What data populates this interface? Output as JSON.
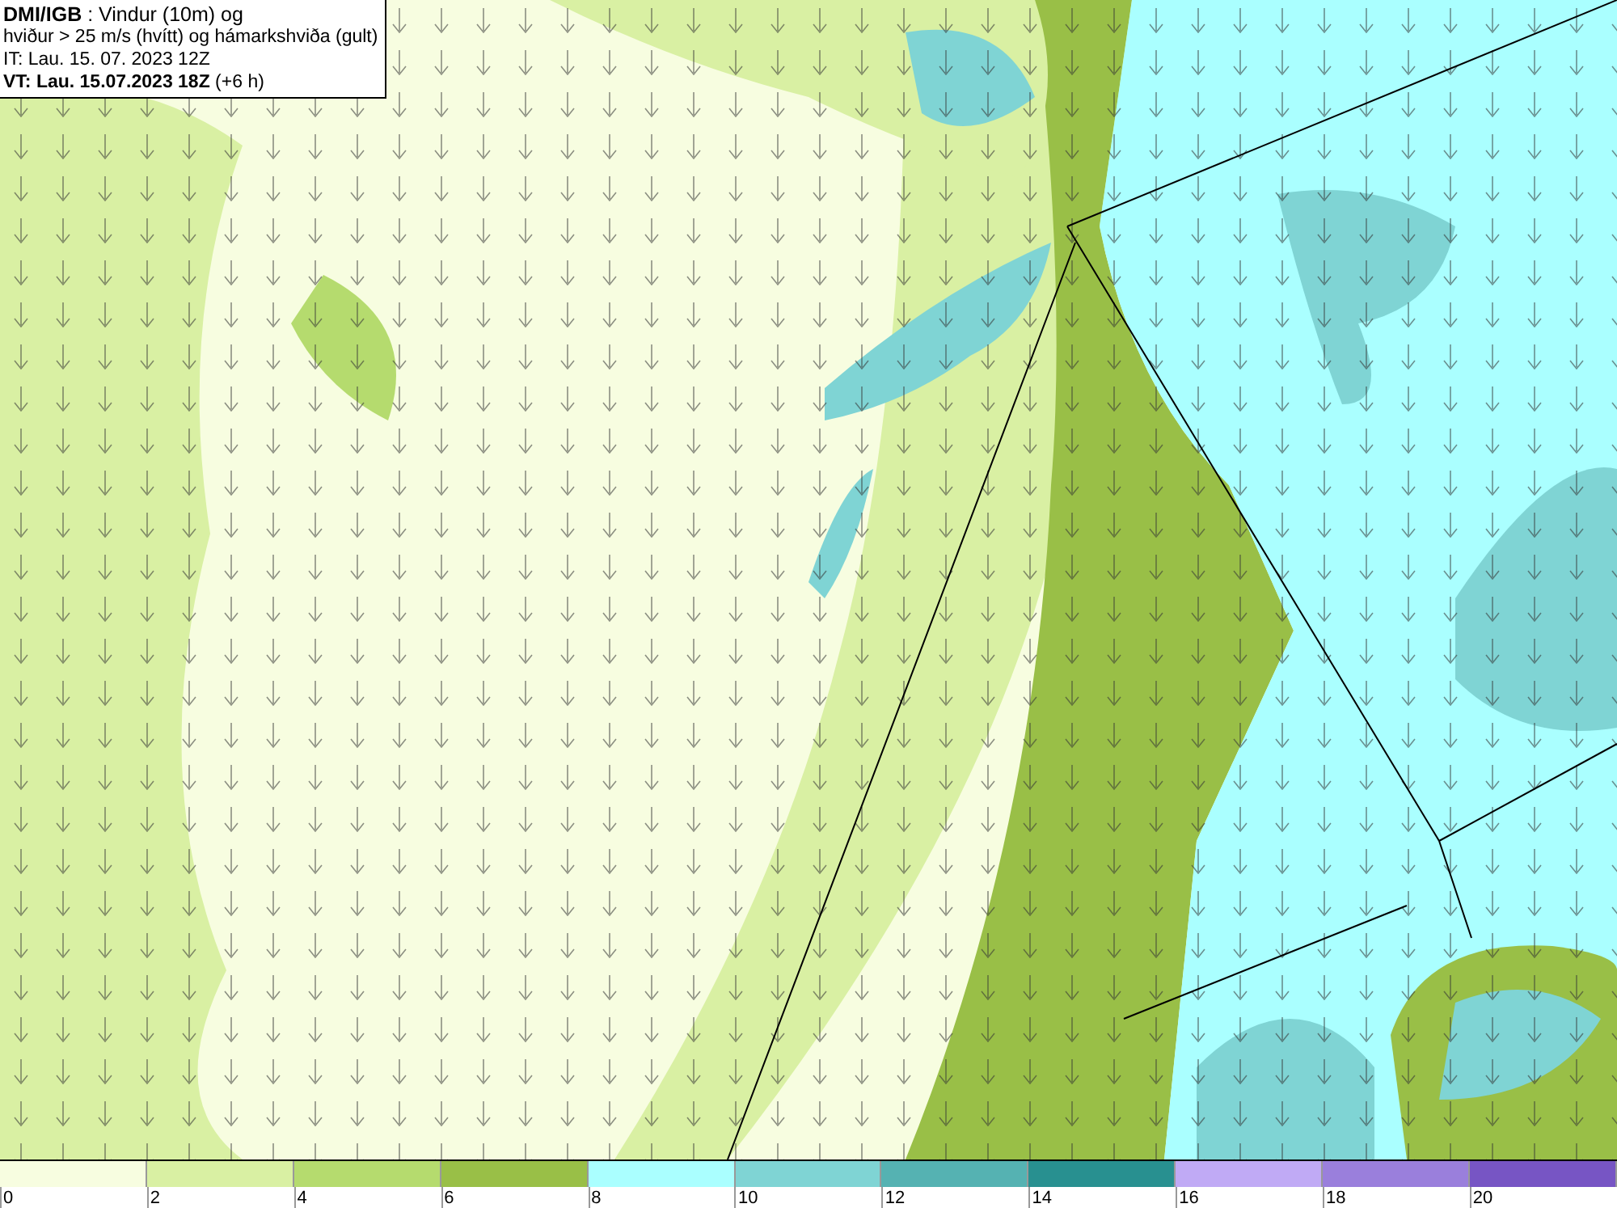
{
  "header": {
    "lines": [
      "**DMI/IGB** : Vindur (10m) og",
      "hviður > 25 m/s (hvítt) og hámarkshviða (gult)",
      "IT: Lau. 15. 07. 2023 12Z",
      "**VT: Lau. 15.07.2023 18Z** (+6 h)"
    ]
  },
  "legend": {
    "bins": [
      {
        "color": "#f7fde0"
      },
      {
        "color": "#d9f0a3"
      },
      {
        "color": "#b5db6e"
      },
      {
        "color": "#99bf47"
      },
      {
        "color": "#aaffff"
      },
      {
        "color": "#7fd4d4"
      },
      {
        "color": "#55b2b2"
      },
      {
        "color": "#289090"
      },
      {
        "color": "#c0aaf5"
      },
      {
        "color": "#9a7fdc"
      },
      {
        "color": "#7755c4"
      }
    ],
    "ticks": [
      "0",
      "2",
      "4",
      "6",
      "8",
      "10",
      "12",
      "14",
      "16",
      "18",
      "20"
    ]
  }
}
